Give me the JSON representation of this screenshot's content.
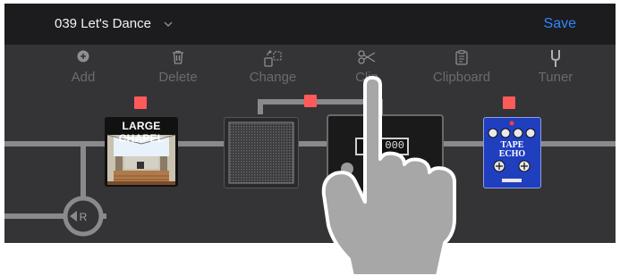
{
  "header": {
    "preset_name": "039 Let's Dance",
    "save_label": "Save"
  },
  "toolbar": {
    "items": [
      {
        "label": "Add",
        "icon": "plus-circle-icon"
      },
      {
        "label": "Delete",
        "icon": "trash-icon"
      },
      {
        "label": "Change",
        "icon": "swap-icon"
      },
      {
        "label": "Clip",
        "icon": "scissors-icon"
      },
      {
        "label": "Clipboard",
        "icon": "clipboard-icon"
      },
      {
        "label": "Tuner",
        "icon": "tuning-fork-icon"
      }
    ]
  },
  "chain": {
    "reverb_label": "LARGE CHAPEL",
    "delay_label_top": "TAPE",
    "delay_label_bottom": "ECHO",
    "amp_display": "000",
    "return_label": "R"
  },
  "colors": {
    "accent": "#2f86ff",
    "block_selector": "#ff5a5a",
    "background": "#343436",
    "header": "#1c1c1e",
    "signal_line": "#8a8a8c",
    "delay_pedal": "#1f3fbf"
  }
}
